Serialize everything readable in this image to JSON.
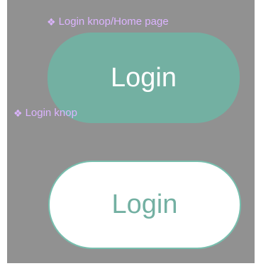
{
  "colors": {
    "canvas_background": "#919191",
    "frame_label": "#dcb4ff",
    "primary_button_bg": "#73b0a2",
    "primary_button_text": "#ffffff",
    "secondary_button_bg": "#ffffff",
    "secondary_button_text": "#73b0a2"
  },
  "frames": {
    "home_page_label": "Login knop/Home page",
    "knop_label": "Login knop",
    "icon": "component-diamond-icon"
  },
  "buttons": {
    "primary_label": "Login",
    "secondary_label": "Login"
  }
}
